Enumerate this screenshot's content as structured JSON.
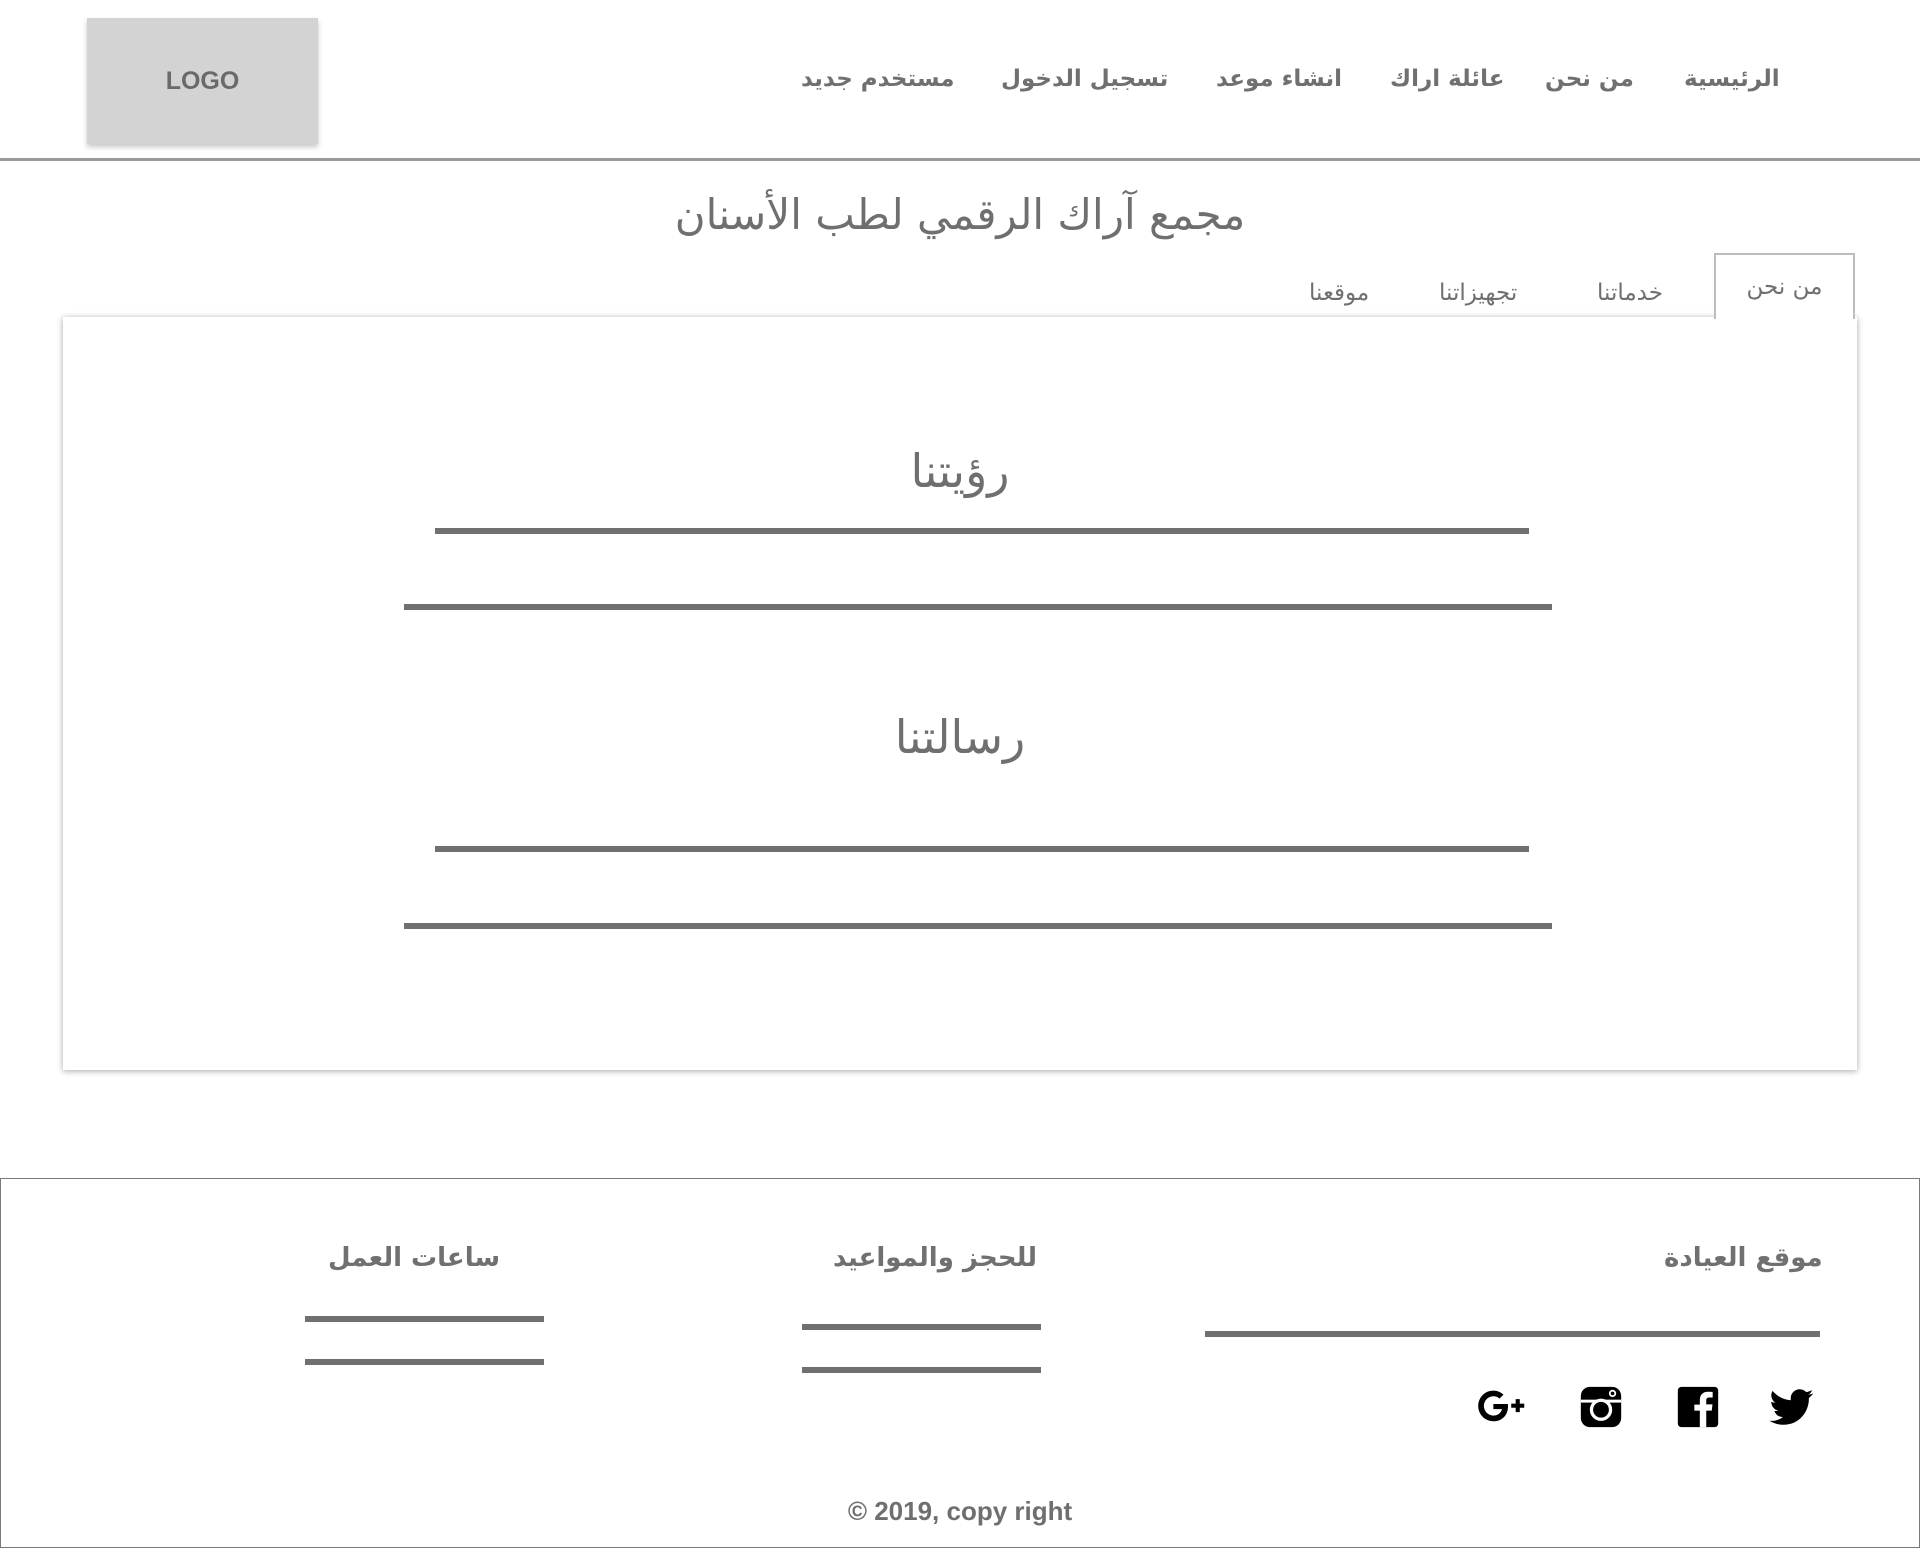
{
  "header": {
    "logo_text": "LOGO",
    "nav": {
      "home": "الرئيسية",
      "about": "من نحن",
      "arak_family": "عائلة اراك",
      "new_appointment": "انشاء موعد",
      "login": "تسجيل الدخول",
      "new_user": "مستخدم جديد"
    }
  },
  "page": {
    "title": "مجمع آراك الرقمي لطب الأسنان"
  },
  "tabs": {
    "about": "من نحن",
    "services": "خدماتنا",
    "equipment": "تجهيزاتنا",
    "location": "موقعنا",
    "active": "about"
  },
  "panel": {
    "vision_heading": "رؤيتنا",
    "mission_heading": "رسالتنا"
  },
  "footer": {
    "clinic_location_heading": "موقع العيادة",
    "booking_heading": "للحجز والمواعيد",
    "hours_heading": "ساعات العمل",
    "social_icons": [
      "twitter-icon",
      "facebook-icon",
      "instagram-icon",
      "google-plus-icon"
    ],
    "copyright": "© 2019, copy right"
  }
}
